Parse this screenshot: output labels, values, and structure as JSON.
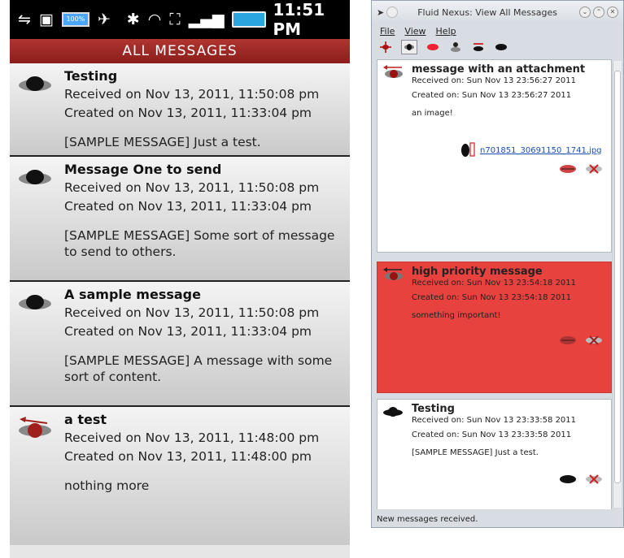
{
  "phone": {
    "status_time": "11:51 PM",
    "battery_text": "100%",
    "title": "ALL MESSAGES",
    "messages": [
      {
        "title": "Testing",
        "received": "Received on Nov 13, 2011, 11:50:08 pm",
        "created": "Created on Nov 13, 2011, 11:33:04 pm",
        "body": "[SAMPLE MESSAGE] Just a test.",
        "icon": "sent-icon"
      },
      {
        "title": "Message One to send",
        "received": "Received on Nov 13, 2011, 11:50:08 pm",
        "created": "Created on Nov 13, 2011, 11:33:04 pm",
        "body": "[SAMPLE MESSAGE] Some sort of message to send to others.",
        "icon": "sent-icon"
      },
      {
        "title": "A sample message",
        "received": "Received on Nov 13, 2011, 11:50:08 pm",
        "created": "Created on Nov 13, 2011, 11:33:04 pm",
        "body": "[SAMPLE MESSAGE] A message with some sort of content.",
        "icon": "sent-icon"
      },
      {
        "title": "a test",
        "received": "Received on Nov 13, 2011, 11:48:00 pm",
        "created": "Created on Nov 13, 2011, 11:48:00 pm",
        "body": "nothing more",
        "icon": "outgoing-red-icon"
      }
    ]
  },
  "desktop": {
    "window_title": "Fluid Nexus: View All Messages",
    "menu": [
      "File",
      "View",
      "Help"
    ],
    "messages": [
      {
        "title": "message with an attachment",
        "received": "Received on: Sun Nov 13 23:56:27 2011",
        "created": "Created on: Sun Nov 13 23:56:27 2011",
        "body": "an image!",
        "attachment": "n701851_30691150_1741.jpg",
        "bg": "#ffffff"
      },
      {
        "title": "high priority message",
        "received": "Received on: Sun Nov 13 23:54:18 2011",
        "created": "Created on: Sun Nov 13 23:54:18 2011",
        "body": "something important!",
        "bg": "#e8423f"
      },
      {
        "title": "Testing",
        "received": "Received on: Sun Nov 13 23:33:58 2011",
        "created": "Created on: Sun Nov 13 23:33:58 2011",
        "body": "[SAMPLE MESSAGE] Just a test.",
        "bg": "#ffffff"
      }
    ],
    "status_text": "New messages received."
  },
  "colors": {
    "android_title": "#9e2a26",
    "priority_red": "#e8423f",
    "link_blue": "#1a4fb5"
  }
}
